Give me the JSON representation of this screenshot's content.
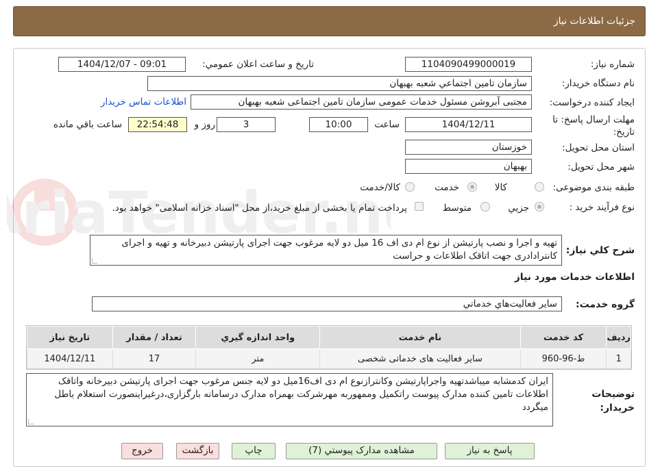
{
  "header": {
    "title": "جزئیات اطلاعات نیاز"
  },
  "fields": {
    "need_number_label": "شماره نیاز:",
    "need_number": "1104090499000019",
    "announce_label": "تاریخ و ساعت اعلان عمومي:",
    "announce_value": "1404/12/07 - 09:01",
    "buyer_org_label": "نام دستگاه خريدار:",
    "buyer_org": "سازمان تامين اجتماعي شعبه بهبهان",
    "requester_label": "ايجاد کننده درخواست:",
    "requester": "مجتبی آبروشن مسئول خدمات عمومی سازمان تامین اجتماعی شعبه بهبهان",
    "contact_link": "اطلاعات تماس خریدار",
    "deadline_label": "مهلت ارسال پاسخ: تا تاریخ:",
    "deadline_date": "1404/12/11",
    "time_label": "ساعت",
    "deadline_time": "10:00",
    "days": "3",
    "days_label": "روز و",
    "remaining_time": "22:54:48",
    "remaining_label": "ساعت باقي مانده",
    "province_label": "استان محل تحویل:",
    "province": "خوزستان",
    "city_label": "شهر محل تحویل:",
    "city": "بهبهان",
    "category_label": "طبقه بندی موضوعی:",
    "category_options": [
      "کالا",
      "خدمت",
      "کالا/خدمت"
    ],
    "purchase_type_label": "نوع فرآیند خرید :",
    "purchase_type_options": [
      "جزيي",
      "متوسط"
    ],
    "payment_note": "پرداخت تمام یا بخشی از مبلغ خرید،از محل \"اسناد خزانه اسلامی\" خواهد بود."
  },
  "description": {
    "label": "شرح کلي نياز:",
    "text": "تهیه و اجرا و نصب پارتیشن از نوع ام دی اف 16 میل دو لایه مرغوب جهت اجرای پارتیشن دبیرخانه و تهیه و اجرای کانترادادری جهت اتاقک اطلاعات و حراست"
  },
  "services_section": {
    "title": "اطلاعات خدمات مورد نیاز",
    "group_label": "گروه خدمت:",
    "group_value": "ساير فعاليت‌هاي خدماتي"
  },
  "table": {
    "headers": [
      "رديف",
      "کد خدمت",
      "نام خدمت",
      "واحد اندازه گيري",
      "تعداد / مقدار",
      "تاريخ نياز"
    ],
    "rows": [
      [
        "1",
        "ط-96-960",
        "سایر فعالیت های خدماتی شخصی",
        "متر",
        "17",
        "1404/12/11"
      ]
    ]
  },
  "buyer_notes": {
    "label": "توضيحات خريدار:",
    "text": "ایران کدمشابه میباشدتهیه واجراپارتیشن وکانترازنوع ام دی اف16میل دو لایه جنس مرغوب جهت اجرای پارتیشن دبیرخانه واتاقک اطلاعات تامین کننده مدارک پیوست راتکمیل وممهوربه مهرشرکت بهمراه مدارک درسامانه بارگزاری،درغیراینصورت استعلام باطل میگردد"
  },
  "buttons": {
    "reply": "پاسخ به نياز",
    "attachments": "مشاهده مدارک پيوستي (7)",
    "print": "چاپ",
    "back": "بازگشت",
    "exit": "خروج"
  },
  "watermark": "AriaTender.neT",
  "colors": {
    "header": "#8b6a45",
    "link": "#1a4fd0",
    "green_button": "#dff2d8",
    "pink_button": "#fbdede",
    "remaining_bg": "#ffffcc"
  }
}
